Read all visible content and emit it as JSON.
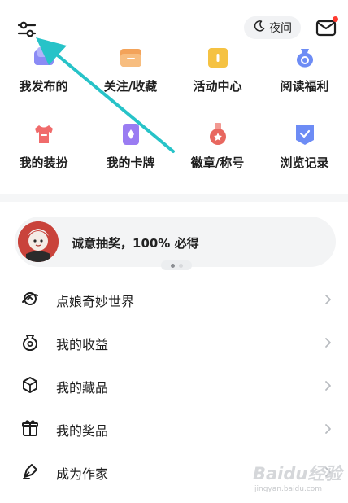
{
  "header": {
    "night_label": "夜间",
    "settings_icon": "sliders-icon",
    "mail_icon": "mail-icon",
    "mail_badge_color": "#ff3b30"
  },
  "grid": {
    "items": [
      {
        "label": "我发布的",
        "icon": "my-posts-icon",
        "color": "#7c7cf2"
      },
      {
        "label": "关注/收藏",
        "icon": "folder-icon",
        "color": "#f3a35a"
      },
      {
        "label": "活动中心",
        "icon": "gift-box-icon",
        "color": "#f5c242"
      },
      {
        "label": "阅读福利",
        "icon": "money-bag-icon",
        "color": "#6d8cf5"
      },
      {
        "label": "我的装扮",
        "icon": "tshirt-icon",
        "color": "#f06b6b"
      },
      {
        "label": "我的卡牌",
        "icon": "card-icon",
        "color": "#9a7cf2"
      },
      {
        "label": "徽章/称号",
        "icon": "medal-icon",
        "color": "#e8675f"
      },
      {
        "label": "浏览记录",
        "icon": "history-icon",
        "color": "#6d8cf5"
      }
    ]
  },
  "banner": {
    "text": "诚意抽奖，100% 必得",
    "active_page": 1,
    "page_count": 2
  },
  "menu": {
    "items": [
      {
        "label": "点娘奇妙世界",
        "icon": "planet-icon"
      },
      {
        "label": "我的收益",
        "icon": "income-bag-icon"
      },
      {
        "label": "我的藏品",
        "icon": "cube-icon"
      },
      {
        "label": "我的奖品",
        "icon": "gift-icon"
      },
      {
        "label": "成为作家",
        "icon": "pen-nib-icon"
      }
    ]
  },
  "annotation": {
    "arrow_color": "#27c3c8"
  },
  "watermark": {
    "main": "Baidu经验",
    "sub": "jingyan.baidu.com"
  }
}
